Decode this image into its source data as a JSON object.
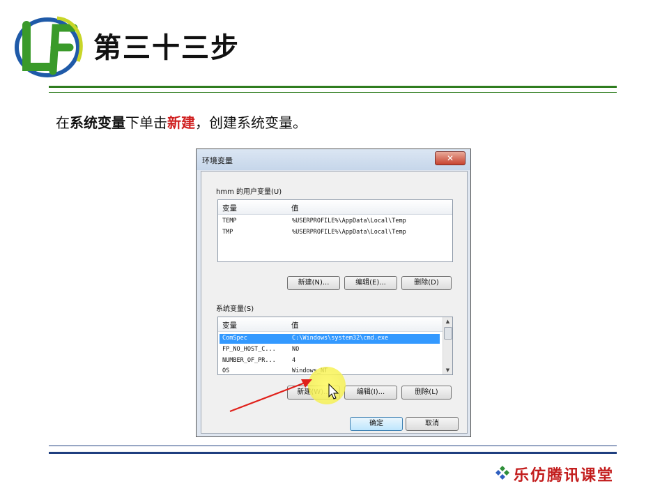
{
  "slide": {
    "title": "第三十三步",
    "instruction": {
      "part1": "在",
      "part2_bold": "系统变量",
      "part3": "下单击",
      "part4_red": "新建",
      "part5": "，创建系统变量。"
    },
    "footer_brand": "乐仿腾讯课堂"
  },
  "dialog": {
    "title": "环境变量",
    "close_glyph": "✕",
    "user_group_label": "hmm 的用户变量(U)",
    "user_columns": [
      "变量",
      "值"
    ],
    "user_rows": [
      {
        "name": "TEMP",
        "value": "%USERPROFILE%\\AppData\\Local\\Temp"
      },
      {
        "name": "TMP",
        "value": "%USERPROFILE%\\AppData\\Local\\Temp"
      }
    ],
    "user_buttons": {
      "new": "新建(N)...",
      "edit": "编辑(E)...",
      "delete": "删除(D)"
    },
    "sys_group_label": "系统变量(S)",
    "sys_columns": [
      "变量",
      "值"
    ],
    "sys_rows": [
      {
        "name": "ComSpec",
        "value": "C:\\Windows\\system32\\cmd.exe",
        "selected": true
      },
      {
        "name": "FP_NO_HOST_C...",
        "value": "NO",
        "selected": false
      },
      {
        "name": "NUMBER_OF_PR...",
        "value": "4",
        "selected": false
      },
      {
        "name": "OS",
        "value": "Windows_NT",
        "selected": false
      }
    ],
    "sys_buttons": {
      "new": "新建(W)...",
      "edit": "编辑(I)...",
      "delete": "删除(L)"
    },
    "ok": "确定",
    "cancel": "取消"
  },
  "colors": {
    "accent_green": "#2f7d1f",
    "rule_blue": "#1f3f7f",
    "brand_red": "#c31d1d",
    "selection_blue": "#3399ff"
  },
  "icons": [
    "lf-logo-icon",
    "close-icon",
    "mouse-cursor-icon",
    "red-arrow-icon",
    "diamond-cluster-icon"
  ]
}
